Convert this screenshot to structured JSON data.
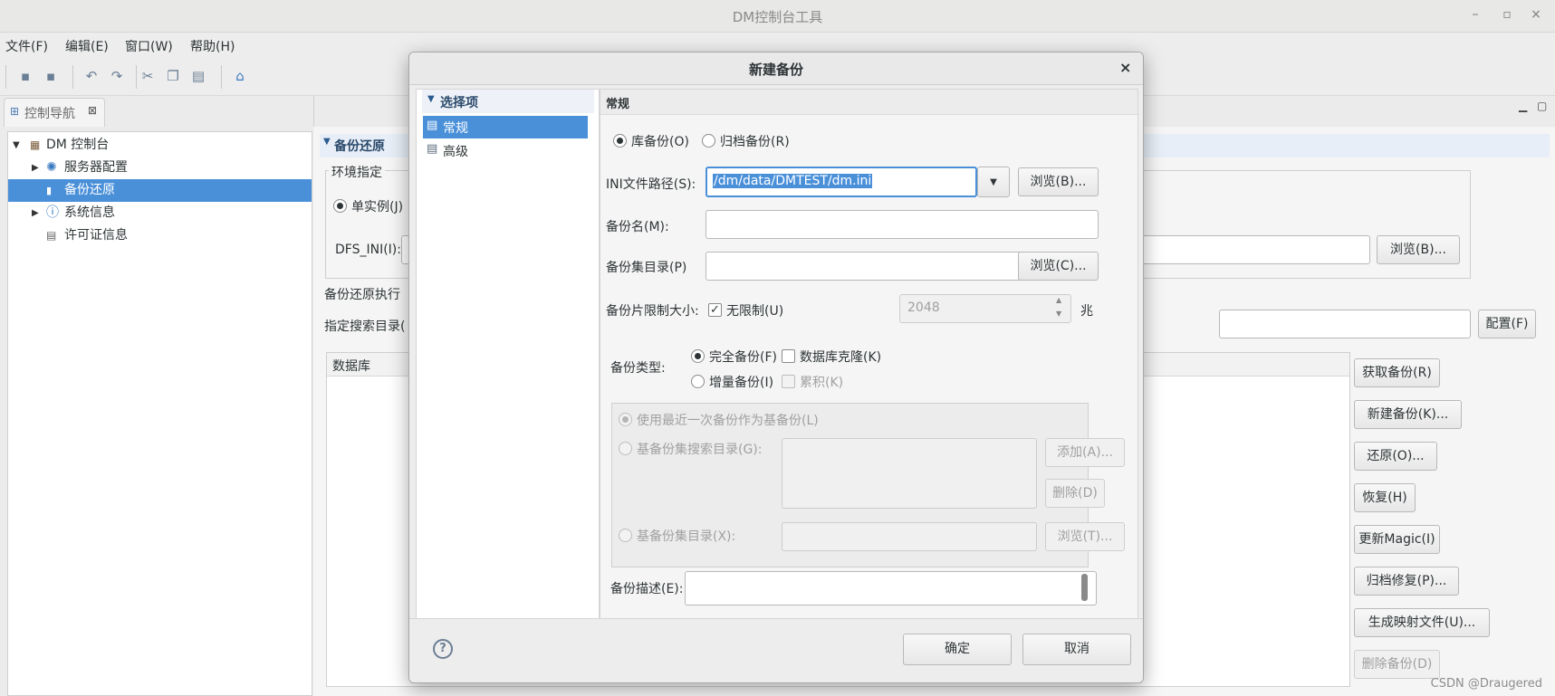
{
  "window": {
    "title": "DM控制台工具",
    "controls": [
      "–",
      "▫",
      "×"
    ]
  },
  "menu": [
    "文件(F)",
    "编辑(E)",
    "窗口(W)",
    "帮助(H)"
  ],
  "nav": {
    "tab_label": "控制导航",
    "tree": [
      {
        "label": "DM 控制台",
        "level": 0
      },
      {
        "label": "服务器配置",
        "level": 1
      },
      {
        "label": "备份还原",
        "level": 1,
        "selected": true
      },
      {
        "label": "系统信息",
        "level": 1
      },
      {
        "label": "许可证信息",
        "level": 1
      }
    ]
  },
  "editor": {
    "section_title": "备份还原",
    "env_label": "环境指定",
    "single_instance": "单实例(J)",
    "dfs_ini": "DFS_INI(I):",
    "browse_b": "浏览(B)...",
    "backup_restore_exec": "备份还原执行",
    "search_dir": "指定搜索目录(",
    "config_btn": "配置(F)",
    "table_header": "数据库",
    "actions": [
      "获取备份(R)",
      "新建备份(K)...",
      "还原(O)...",
      "恢复(H)",
      "更新Magic(I)",
      "归档修复(P)...",
      "生成映射文件(U)...",
      "删除备份(D)"
    ]
  },
  "dialog": {
    "title": "新建备份",
    "options_header": "选择项",
    "options": [
      "常规",
      "高级"
    ],
    "section": "常规",
    "backup_mode": {
      "db": "库备份(O)",
      "archive": "归档备份(R)"
    },
    "ini_label": "INI文件路径(S):",
    "ini_value": "/dm/data/DMTEST/dm.ini",
    "browse_b": "浏览(B)...",
    "backup_name_label": "备份名(M):",
    "backup_name_value": "",
    "backup_dir_label": "备份集目录(P)",
    "backup_dir_value": "",
    "browse_c": "浏览(C)...",
    "piece_limit_label": "备份片限制大小:",
    "unlimited": "无限制(U)",
    "piece_size": "2048",
    "unit": "兆",
    "type_label": "备份类型:",
    "full": "完全备份(F)",
    "clone": "数据库克隆(K)",
    "incremental": "增量备份(I)",
    "cumulative": "累积(K)",
    "use_latest": "使用最近一次备份作为基备份(L)",
    "base_search_dir": "基备份集搜索目录(G):",
    "add_btn": "添加(A)...",
    "delete_btn": "删除(D)",
    "base_dir": "基备份集目录(X):",
    "browse_t": "浏览(T)...",
    "desc_label": "备份描述(E):",
    "desc_value": "",
    "ok": "确定",
    "cancel": "取消",
    "help_icon": "?"
  },
  "watermark": "CSDN @Draugered"
}
